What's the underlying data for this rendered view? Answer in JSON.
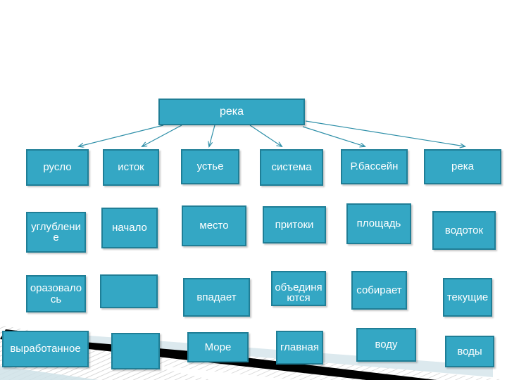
{
  "slide": {
    "background_color": "#FFFFFF",
    "node_fill_color": "#34A7C4",
    "node_border_color": "#1F7E96",
    "node_text_color": "#FFFFFF",
    "connector_color": "#2E8FA8",
    "decor_band_color": "#000000",
    "decor_hatch_color": "#D9D9D9"
  },
  "root": {
    "label": "река"
  },
  "rows": [
    {
      "name": "row-categories",
      "nodes": [
        {
          "label": "русло"
        },
        {
          "label": "исток"
        },
        {
          "label": "устье"
        },
        {
          "label": "система"
        },
        {
          "label": "Р.бассейн"
        },
        {
          "label": "река"
        }
      ]
    },
    {
      "name": "row-definitions-1",
      "nodes": [
        {
          "label": "углубление"
        },
        {
          "label": "начало"
        },
        {
          "label": "место"
        },
        {
          "label": "притоки"
        },
        {
          "label": "площадь"
        },
        {
          "label": "водоток"
        }
      ]
    },
    {
      "name": "row-definitions-2",
      "nodes": [
        {
          "label": "оразовалось"
        },
        {
          "label": ""
        },
        {
          "label": "впадает"
        },
        {
          "label": "объединяются"
        },
        {
          "label": "собирает"
        },
        {
          "label": "текущие"
        }
      ]
    },
    {
      "name": "row-definitions-3",
      "nodes": [
        {
          "label": "выработанное"
        },
        {
          "label": ""
        },
        {
          "label": "Море"
        },
        {
          "label": "главная"
        },
        {
          "label": "воду"
        },
        {
          "label": "воды"
        }
      ]
    }
  ]
}
